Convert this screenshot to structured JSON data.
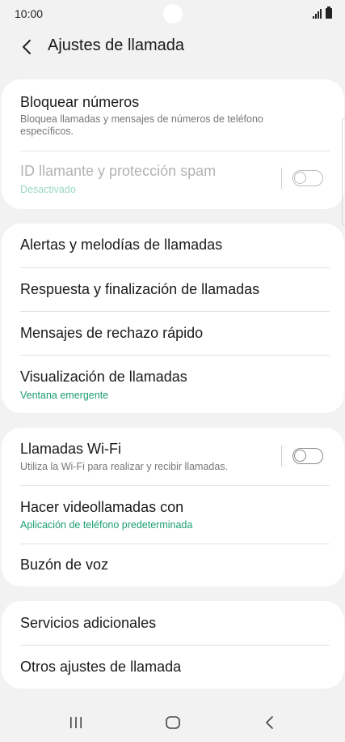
{
  "status_bar": {
    "time": "10:00"
  },
  "header": {
    "title": "Ajustes de llamada"
  },
  "cards": {
    "block": {
      "block_numbers": {
        "title": "Bloquear números",
        "subtitle": "Bloquea llamadas y mensajes de números de teléfono específicos."
      },
      "caller_id": {
        "title": "ID llamante y protección spam",
        "subtitle": "Desactivado",
        "toggle": "off",
        "enabled": false
      }
    },
    "alerts": {
      "ringtones": {
        "title": "Alertas y melodías de llamadas"
      },
      "answer_end": {
        "title": "Respuesta y finalización de llamadas"
      },
      "quick_decline": {
        "title": "Mensajes de rechazo rápido"
      },
      "call_display": {
        "title": "Visualización de llamadas",
        "subtitle": "Ventana emergente"
      }
    },
    "wifi": {
      "wifi_calling": {
        "title": "Llamadas Wi-Fi",
        "subtitle": "Utiliza la Wi-Fi para realizar y recibir llamadas.",
        "toggle": "off"
      },
      "video_calls": {
        "title": "Hacer videollamadas con",
        "subtitle": "Aplicación de teléfono predeterminada"
      },
      "voicemail": {
        "title": "Buzón de voz"
      }
    },
    "more": {
      "supplementary": {
        "title": "Servicios adicionales"
      },
      "other": {
        "title": "Otros ajustes de llamada"
      }
    }
  },
  "colors": {
    "accent": "#1a9e6e",
    "background": "#f2f2f2",
    "card": "#ffffff"
  },
  "nav_bar": {
    "recents_icon": "recents-icon",
    "home_icon": "home-icon",
    "back_icon": "back-icon"
  }
}
